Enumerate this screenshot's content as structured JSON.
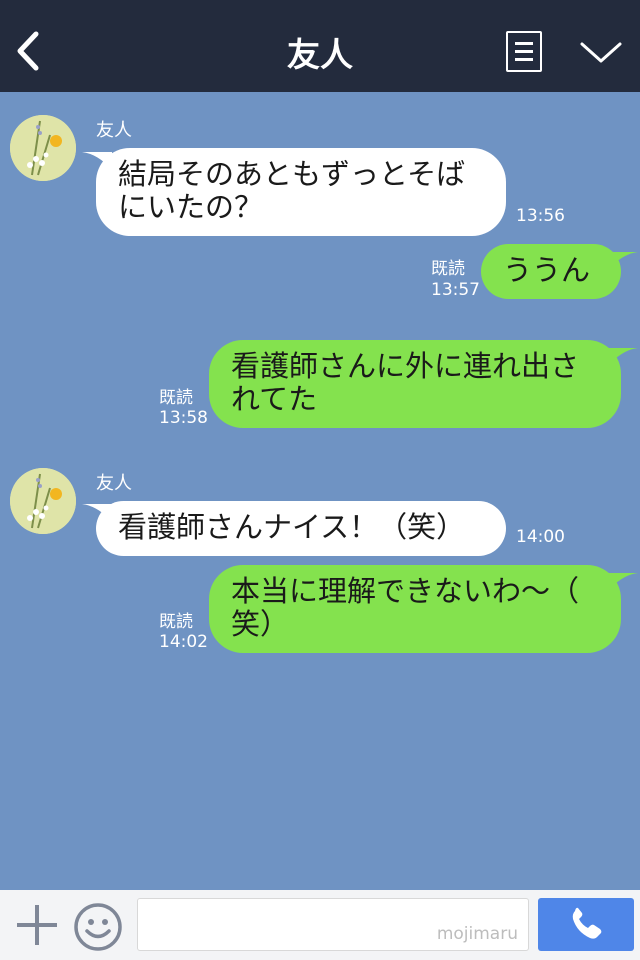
{
  "header": {
    "title": "友人",
    "back_icon": "chevron-left-icon",
    "menu_icon": "menu-list-icon",
    "collapse_icon": "chevron-down-icon"
  },
  "messages": [
    {
      "side": "in",
      "sender": "友人",
      "lines": [
        "結局そのあともずっとそば",
        "にいたの？"
      ],
      "time": "13:56"
    },
    {
      "side": "out",
      "read": "既読",
      "lines": [
        "ううん"
      ],
      "time": "13:57"
    },
    {
      "side": "out",
      "read": "既読",
      "lines": [
        "看護師さんに外に連れ出さ",
        "れてた"
      ],
      "time": "13:58"
    },
    {
      "side": "in",
      "sender": "友人",
      "lines": [
        "看護師さんナイス！（笑）"
      ],
      "time": "14:00"
    },
    {
      "side": "out",
      "read": "既読",
      "lines": [
        "本当に理解できないわ〜（",
        "笑）"
      ],
      "time": "14:02"
    }
  ],
  "footer": {
    "plus_icon": "plus-icon",
    "emoji_icon": "smiley-icon",
    "input_value": "",
    "watermark": "mojimaru",
    "call_icon": "phone-icon"
  },
  "colors": {
    "header_bg": "#232b3d",
    "chat_bg": "#6f93c3",
    "outgoing_bubble": "#84e24e",
    "incoming_bubble": "#ffffff",
    "call_button": "#4f86e8"
  }
}
